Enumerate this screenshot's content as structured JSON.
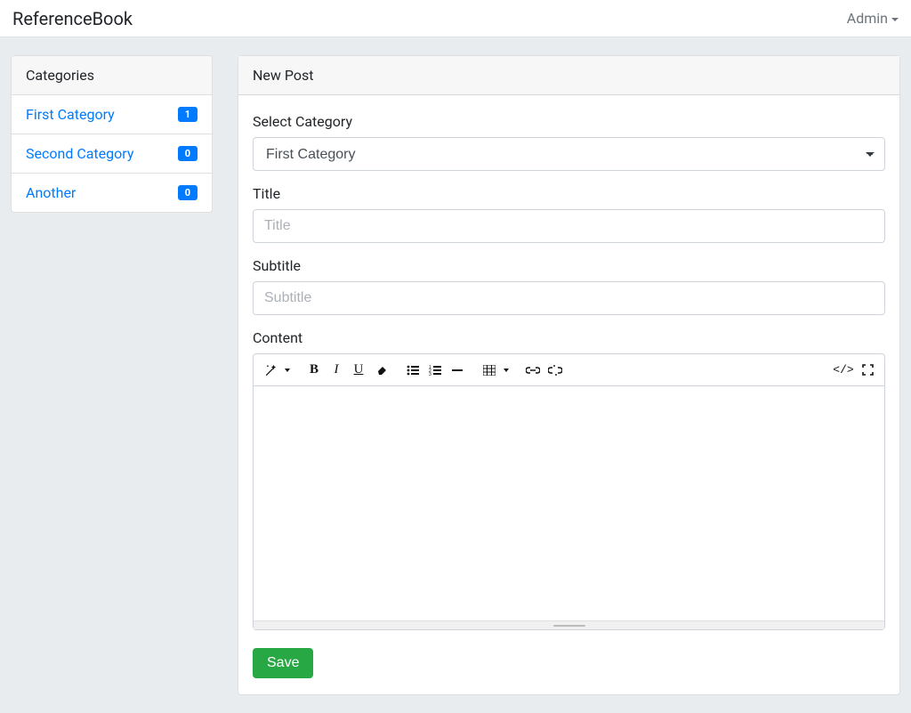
{
  "nav": {
    "brand": "ReferenceBook",
    "user": "Admin"
  },
  "sidebar": {
    "heading": "Categories",
    "items": [
      {
        "label": "First Category",
        "count": "1"
      },
      {
        "label": "Second Category",
        "count": "0"
      },
      {
        "label": "Another",
        "count": "0"
      }
    ]
  },
  "form": {
    "heading": "New Post",
    "category_label": "Select Category",
    "category_selected": "First Category",
    "title_label": "Title",
    "title_placeholder": "Title",
    "subtitle_label": "Subtitle",
    "subtitle_placeholder": "Subtitle",
    "content_label": "Content",
    "save_label": "Save"
  }
}
